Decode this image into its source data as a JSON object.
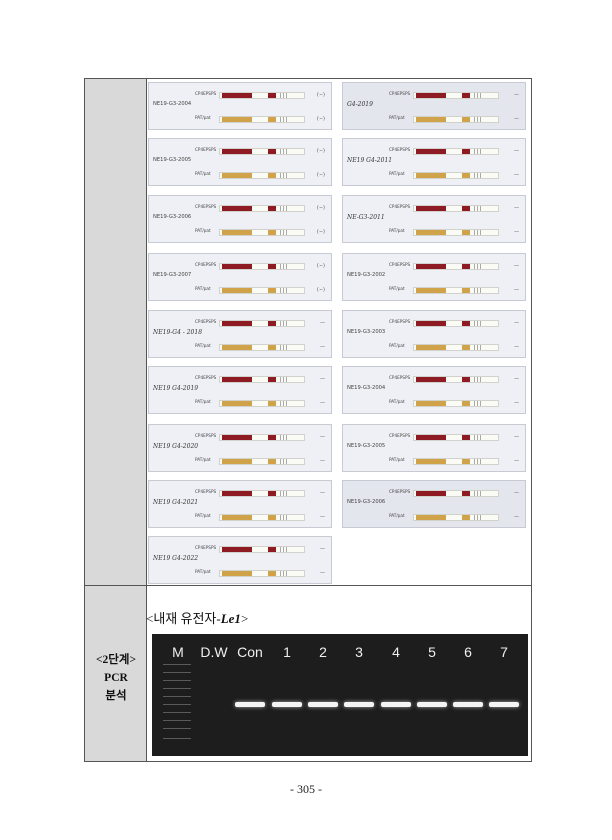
{
  "stage": {
    "line1": "<2단계>",
    "line2": "PCR",
    "line3": "분석"
  },
  "gel": {
    "title_prefix": "<내재 유전자-",
    "gene": "Le1",
    "title_suffix": ">",
    "lanes": [
      "M",
      "D.W",
      "Con",
      "1",
      "2",
      "3",
      "4",
      "5",
      "6",
      "7"
    ]
  },
  "strip_labels": {
    "a": "CP4EPSPS",
    "b": "PAT/pat"
  },
  "panels_left": [
    {
      "id": "NE19-G3-2004",
      "res_a": "(−)",
      "res_b": "(−)"
    },
    {
      "id": "NE19-G3-2005",
      "res_a": "(−)",
      "res_b": "(−)"
    },
    {
      "id": "NE19-G3-2006",
      "res_a": "(−)",
      "res_b": "(−)"
    },
    {
      "id": "NE19-G3-2007",
      "res_a": "(−)",
      "res_b": "(−)"
    },
    {
      "id": "NE19-G4 - 2018",
      "res_a": "—",
      "res_b": "—"
    },
    {
      "id": "NE19 G4-2019",
      "res_a": "—",
      "res_b": "—"
    },
    {
      "id": "NE19 G4-2020",
      "res_a": "—",
      "res_b": "—"
    },
    {
      "id": "NE19 G4-2021",
      "res_a": "—",
      "res_b": "—"
    },
    {
      "id": "NE19 G4-2022",
      "res_a": "—",
      "res_b": "—"
    }
  ],
  "panels_right": [
    {
      "id": "G4-2019",
      "res_a": "—",
      "res_b": "—"
    },
    {
      "id": "NE19 G4-2011",
      "res_a": "—",
      "res_b": "—"
    },
    {
      "id": "NE-G3-2011",
      "res_a": "—",
      "res_b": "—"
    },
    {
      "id": "NE19-G3-2002",
      "res_a": "—",
      "res_b": "—"
    },
    {
      "id": "NE19-G3-2003",
      "res_a": "—",
      "res_b": "—"
    },
    {
      "id": "NE19-G3-2004",
      "res_a": "—",
      "res_b": "—"
    },
    {
      "id": "NE19-G3-2005",
      "res_a": "—",
      "res_b": "—"
    },
    {
      "id": "NE19-G3-2006",
      "res_a": "—",
      "res_b": "—"
    }
  ],
  "page_number": "- 305 -"
}
